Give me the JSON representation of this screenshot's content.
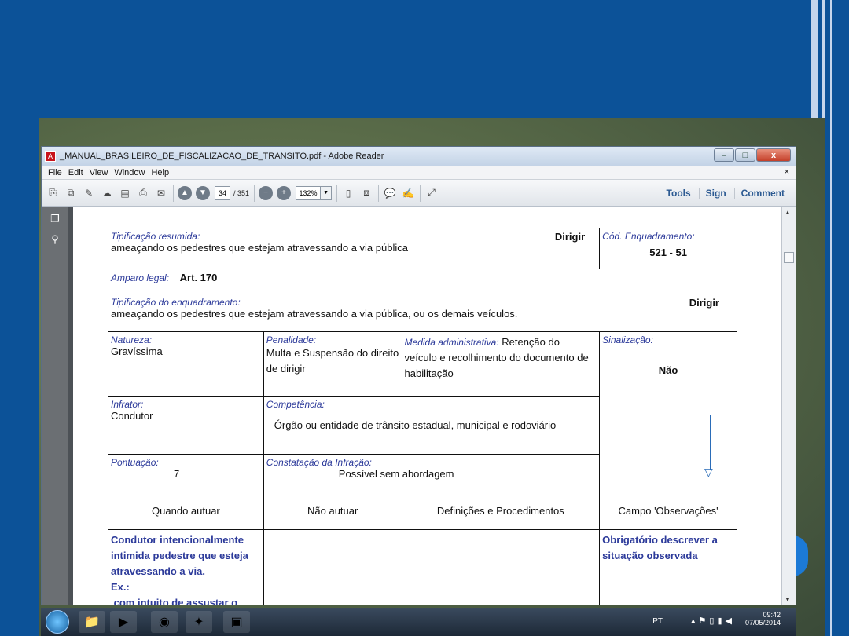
{
  "window": {
    "title": "_MANUAL_BRASILEIRO_DE_FISCALIZACAO_DE_TRANSITO.pdf - Adobe Reader",
    "minimize": "–",
    "maximize": "□",
    "close": "x"
  },
  "menu": {
    "items": [
      "File",
      "Edit",
      "View",
      "Window",
      "Help"
    ],
    "close": "×"
  },
  "toolbar": {
    "page_current": "34",
    "page_total": "/ 351",
    "zoom": "132%",
    "tools": "Tools",
    "sign": "Sign",
    "comment": "Comment"
  },
  "doc": {
    "tip_resumida_label": "Tipificação resumida:",
    "tip_resumida_verb": "Dirigir",
    "tip_resumida_text": "ameaçando os pedestres que estejam atravessando a via pública",
    "cod_label": "Cód. Enquadramento:",
    "cod_value": "521 - 51",
    "amparo_label": "Amparo legal:",
    "amparo_value": "Art. 170",
    "tip_enq_label": "Tipificação do enquadramento:",
    "tip_enq_verb": "Dirigir",
    "tip_enq_text": "ameaçando os pedestres que estejam atravessando a via pública, ou os demais veículos.",
    "natureza_label": "Natureza:",
    "natureza_value": "Gravíssima",
    "penalidade_label": "Penalidade:",
    "penalidade_value": "Multa e Suspensão do direito de dirigir",
    "medida_label": "Medida administrativa:",
    "medida_value_1": "Retenção do",
    "medida_value_2": "veículo e recolhimento do documento de  habilitação",
    "sinalizacao_label": "Sinalização:",
    "sinalizacao_value": "Não",
    "infrator_label": "Infrator:",
    "infrator_value": "Condutor",
    "competencia_label": "Competência:",
    "competencia_value": "Órgão ou entidade de trânsito estadual, municipal e rodoviário",
    "pontuacao_label": "Pontuação:",
    "pontuacao_value": "7",
    "constatacao_label": "Constatação da Infração:",
    "constatacao_value": "Possível sem abordagem",
    "col_headers": [
      "Quando autuar",
      "Não autuar",
      "Definições e Procedimentos",
      "Campo 'Observações'"
    ],
    "quando_autuar": "Condutor intencionalmente intimida pedestre que esteja atravessando a via.",
    "ex_label": "Ex.:",
    "ex_text": ".com intuito de assustar o",
    "observacoes": "Obrigatório descrever a situação observada"
  },
  "taskbar": {
    "lang": "PT",
    "time": "09:42",
    "date": "07/05/2014"
  }
}
